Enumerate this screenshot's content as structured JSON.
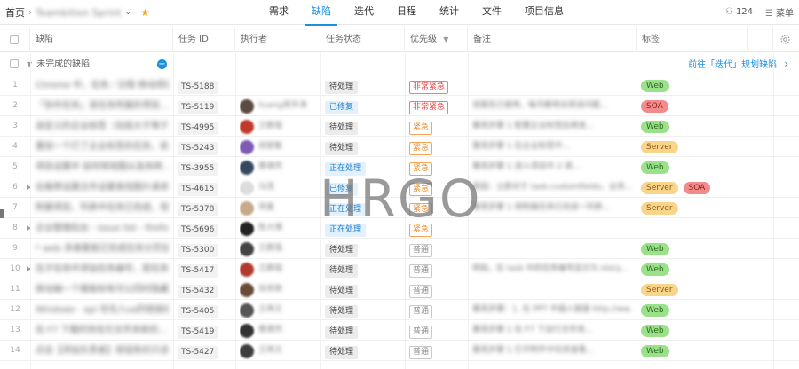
{
  "breadcrumb": {
    "home": "首页",
    "project": "Teambition Sprint"
  },
  "nav": {
    "tabs": [
      "需求",
      "缺陷",
      "迭代",
      "日程",
      "统计",
      "文件",
      "项目信息"
    ],
    "active_index": 1
  },
  "topright": {
    "member_count": "124",
    "menu_label": "菜单"
  },
  "columns": [
    "缺陷",
    "任务 ID",
    "执行者",
    "任务状态",
    "优先级",
    "备注",
    "标签"
  ],
  "group": {
    "title": "未完成的缺陷",
    "link": "前往「迭代」规划缺陷"
  },
  "watermark": "HRGO",
  "colors": {
    "accent": "#1a90e0",
    "tag_web": "#9be08a",
    "tag_server": "#f9d48b",
    "tag_soa": "#f48b8b"
  },
  "rows": [
    {
      "num": "1",
      "title": "Chrome 中，任务／日程 移动项目...",
      "id": "TS-5188",
      "exec": "",
      "status": "待处理",
      "status_style": "gray",
      "prio": "非常紧急",
      "prio_style": "red",
      "note": "",
      "tags": [
        {
          "label": "Web",
          "style": "green"
        }
      ],
      "expand": false
    },
    {
      "num": "2",
      "title": "「协作任务」该任务所属的项目...",
      "id": "TS-5119",
      "exec": "liuang周华涛",
      "status": "已修复",
      "status_style": "blue",
      "prio": "非常紧急",
      "prio_style": "red",
      "note": "该报告已使用，每月都将出现该问题...",
      "tags": [
        {
          "label": "SOA",
          "style": "red"
        }
      ],
      "expand": false
    },
    {
      "num": "3",
      "title": "自定义的企业标签（包括大于等于...",
      "id": "TS-4995",
      "exec": "王鹏强",
      "status": "待处理",
      "status_style": "gray",
      "prio": "紧急",
      "prio_style": "orange",
      "note": "重现步骤 1 配置企业标签后再发...",
      "tags": [
        {
          "label": "Web",
          "style": "green"
        }
      ],
      "expand": false
    },
    {
      "num": "4",
      "title": "重组一个灯了企业标签的任务，依...",
      "id": "TS-5243",
      "exec": "胡家敏",
      "status": "待处理",
      "status_style": "gray",
      "prio": "紧急",
      "prio_style": "orange",
      "note": "重现步骤 1 在企业标签中...",
      "tags": [
        {
          "label": "Server",
          "style": "orange"
        }
      ],
      "expand": false
    },
    {
      "num": "5",
      "title": "项目设置中 如何将视图从急务转...",
      "id": "TS-3955",
      "exec": "曹德然",
      "status": "正在处理",
      "status_style": "blue",
      "prio": "紧急",
      "prio_style": "orange",
      "note": "重现步骤 1 进入项目中 2 将...",
      "tags": [
        {
          "label": "Web",
          "style": "green"
        }
      ],
      "expand": false
    },
    {
      "num": "6",
      "title": "在推荐设置文件设置查找图片请求...",
      "id": "TS-4615",
      "exec": "冯茂",
      "status": "已修复",
      "status_style": "blue",
      "prio": "紧急",
      "prio_style": "orange",
      "note": "原因：立即对于 task.customfields，业务...",
      "tags": [
        {
          "label": "Server",
          "style": "orange"
        },
        {
          "label": "SOA",
          "style": "red"
        }
      ],
      "expand": true
    },
    {
      "num": "7",
      "title": "附属项目，列表中任务已完成，但...",
      "id": "TS-5378",
      "exec": "常嘉",
      "status": "正在处理",
      "status_style": "blue",
      "prio": "紧急",
      "prio_style": "orange",
      "note": "重现步骤 1 将附属任务已完成一列表...",
      "tags": [
        {
          "label": "Server",
          "style": "orange"
        }
      ],
      "expand": false
    },
    {
      "num": "8",
      "title": "企业管理后台 - issue list - firefox",
      "id": "TS-5696",
      "exec": "陈大博",
      "status": "正在处理",
      "status_style": "blue",
      "prio": "紧急",
      "prio_style": "orange",
      "note": "",
      "tags": [],
      "expand": true
    },
    {
      "num": "9",
      "title": "* web 多维看板已完成任务分页加...",
      "id": "TS-5300",
      "exec": "王鹏强",
      "status": "待处理",
      "status_style": "gray",
      "prio": "普通",
      "prio_style": "gray",
      "note": "",
      "tags": [
        {
          "label": "Web",
          "style": "green"
        }
      ],
      "expand": false
    },
    {
      "num": "10",
      "title": "在子任务中添加任务编号，若任务...",
      "id": "TS-5417",
      "exec": "王鹏强",
      "status": "待处理",
      "status_style": "gray",
      "prio": "普通",
      "prio_style": "gray",
      "note": "例如，在 task 中的任务编号显示为 story...",
      "tags": [
        {
          "label": "Web",
          "style": "green"
        }
      ],
      "expand": true
    },
    {
      "num": "11",
      "title": "移动端一个模板标有可以同时隐藏...",
      "id": "TS-5432",
      "exec": "张雨艳",
      "status": "待处理",
      "status_style": "gray",
      "prio": "普通",
      "prio_style": "gray",
      "note": "",
      "tags": [
        {
          "label": "Server",
          "style": "orange"
        }
      ],
      "expand": false
    },
    {
      "num": "12",
      "title": "Windows · api 优化入sa的链接后，点...",
      "id": "TS-5405",
      "exec": "王再文",
      "status": "待处理",
      "status_style": "gray",
      "prio": "普通",
      "prio_style": "gray",
      "note": "重现步骤：1. 在 PPT 中插入链接 http://ww...",
      "tags": [
        {
          "label": "Web",
          "style": "green"
        }
      ],
      "expand": false
    },
    {
      "num": "13",
      "title": "在 F7 下载时存在引文件夹新的...",
      "id": "TS-5419",
      "exec": "曹德然",
      "status": "待处理",
      "status_style": "gray",
      "prio": "普通",
      "prio_style": "gray",
      "note": "重现步骤 1 在 F7 下运行文件夹...",
      "tags": [
        {
          "label": "Web",
          "style": "green"
        }
      ],
      "expand": false
    },
    {
      "num": "14",
      "title": "点击【添加负责者】按钮条的只读...",
      "id": "TS-5427",
      "exec": "王再文",
      "status": "待处理",
      "status_style": "gray",
      "prio": "普通",
      "prio_style": "gray",
      "note": "重现步骤 1 打开附件中任务查看...",
      "tags": [
        {
          "label": "Web",
          "style": "green"
        }
      ],
      "expand": false
    }
  ]
}
